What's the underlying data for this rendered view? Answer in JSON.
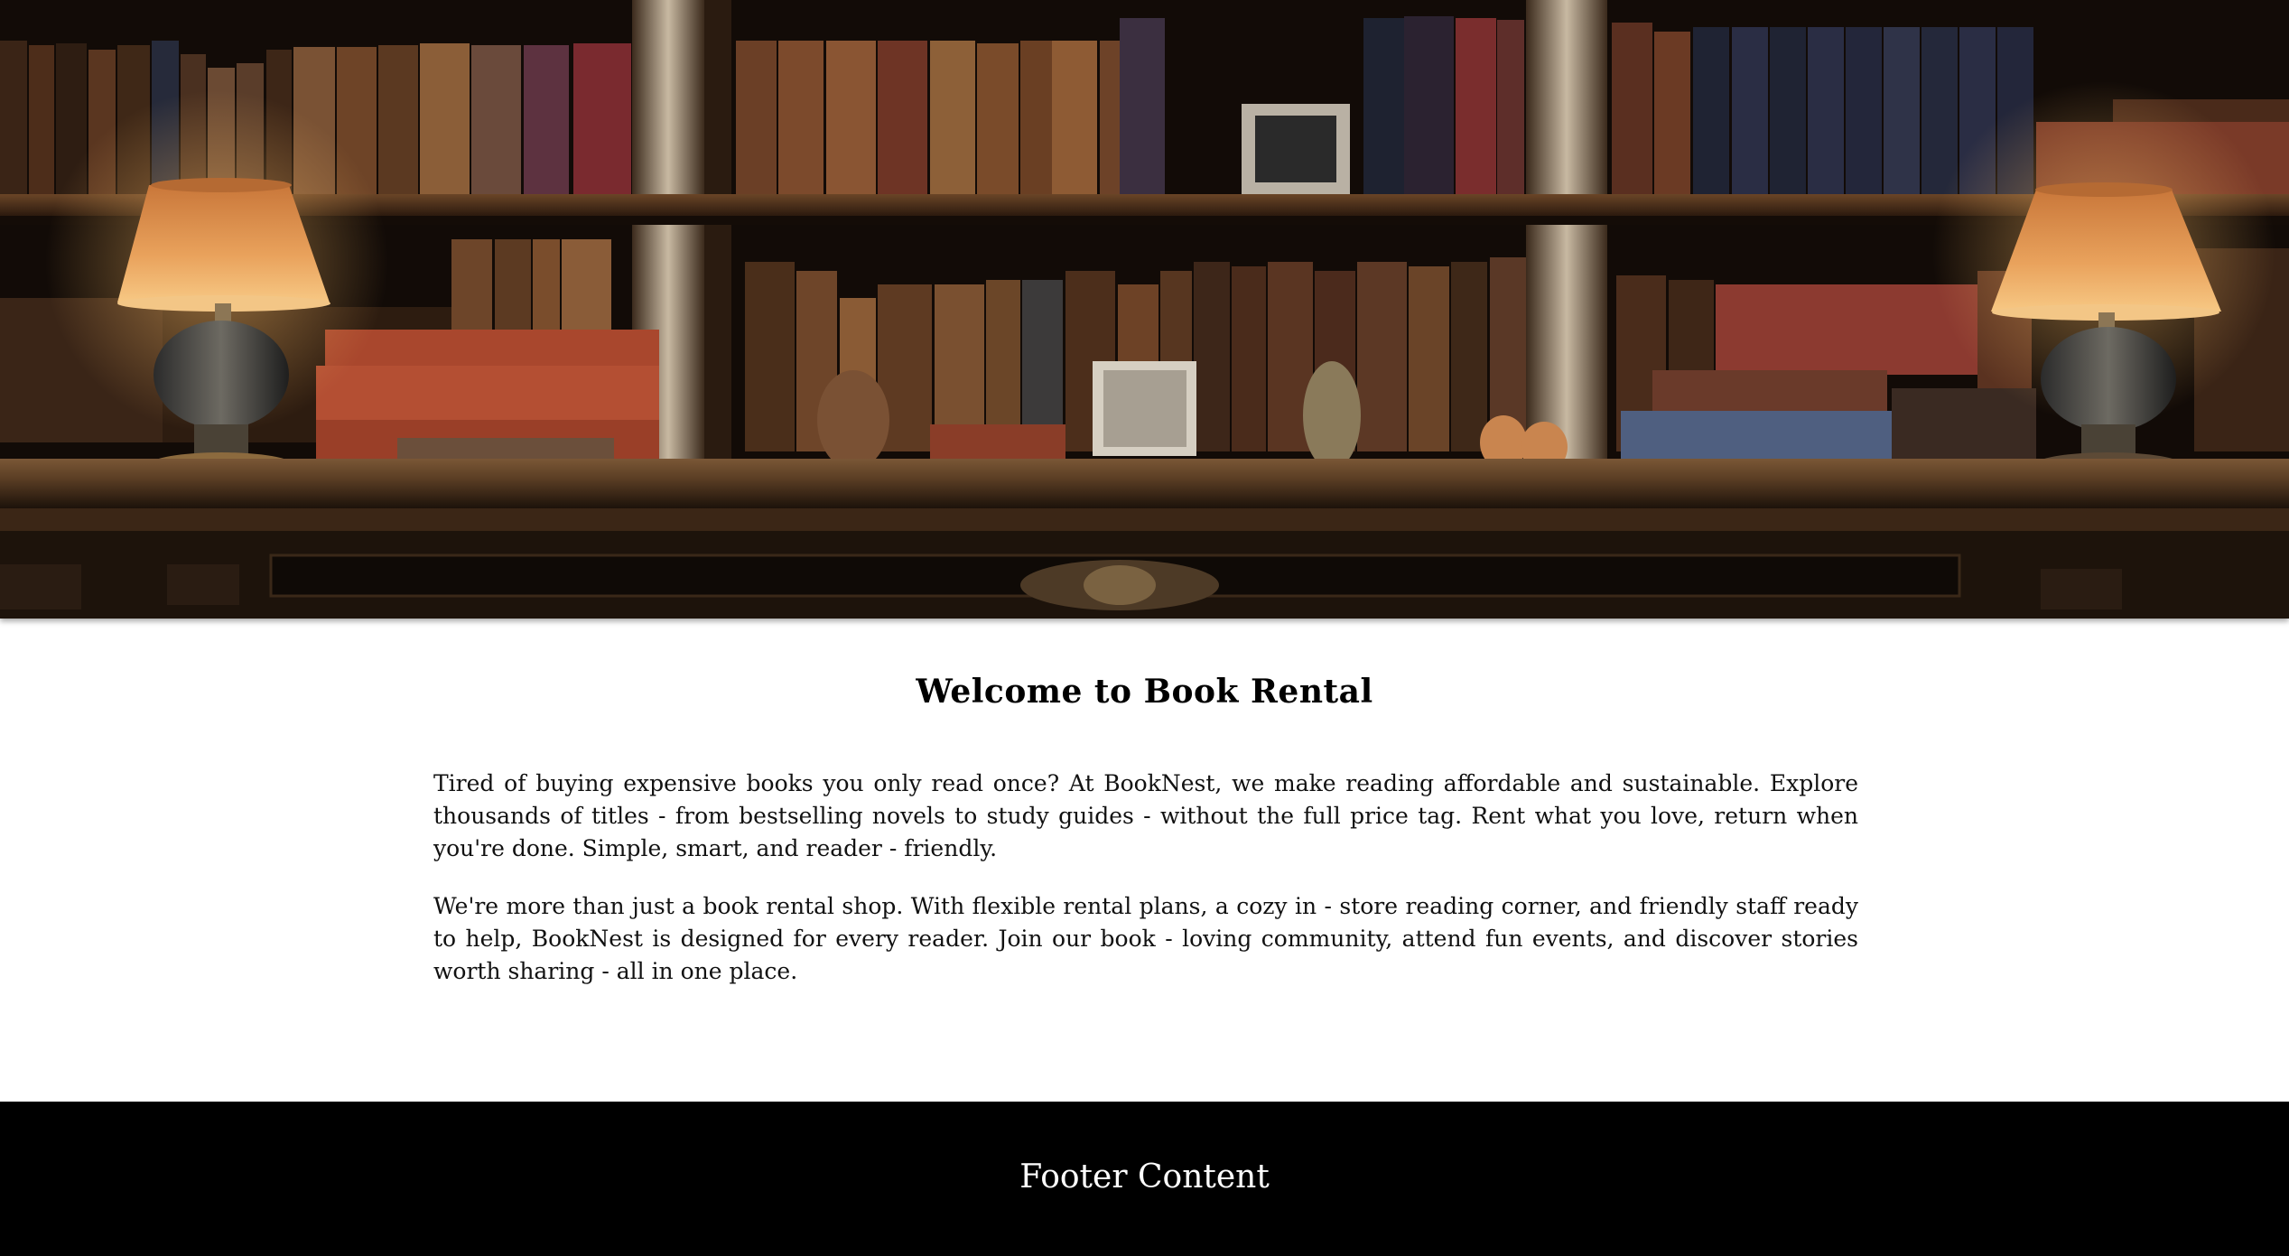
{
  "hero": {
    "image_alt": "Antique bookshelves with leather-bound books, two brass table lamps and ornaments"
  },
  "main": {
    "title": "Welcome to Book Rental",
    "paragraphs": [
      "Tired of buying expensive books you only read once? At BookNest, we make reading affordable and sustainable. Explore thousands of titles - from bestselling novels to study guides - without the full price tag. Rent what you love, return when you're done. Simple, smart, and reader - friendly.",
      "We're more than just a book rental shop. With flexible rental plans, a cozy in - store reading corner, and friendly staff ready to help, BookNest is designed for every reader. Join our book - loving community, attend fun events, and discover stories worth sharing - all in one place."
    ]
  },
  "footer": {
    "text": "Footer Content"
  },
  "colors": {
    "footer_bg": "#000000",
    "page_bg": "#ffffff",
    "text": "#111111",
    "wood_dark": "#2a1a10",
    "lamp_glow": "#e8a24a"
  }
}
